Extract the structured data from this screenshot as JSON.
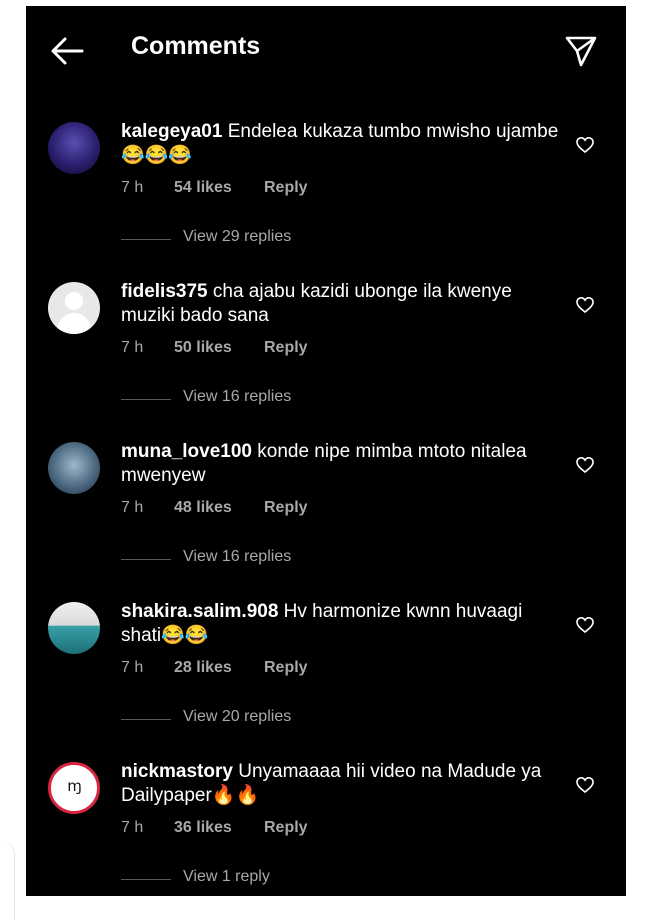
{
  "header": {
    "title": "Comments",
    "back_icon": "arrow-left-icon",
    "send_icon": "paper-plane-icon"
  },
  "comments": [
    {
      "username": "kalegeya01",
      "text": "Endelea kukaza tumbo mwisho ujambe 😂😂😂",
      "time": "7 h",
      "likes": "54 likes",
      "reply": "Reply",
      "view_replies": "View 29 replies"
    },
    {
      "username": "fidelis375",
      "text": "cha ajabu kazidi ubonge ila kwenye muziki bado sana",
      "time": "7 h",
      "likes": "50 likes",
      "reply": "Reply",
      "view_replies": "View 16 replies"
    },
    {
      "username": "muna_love100",
      "text": "konde nipe mimba mtoto nitalea mwenyew",
      "time": "7 h",
      "likes": "48 likes",
      "reply": "Reply",
      "view_replies": "View 16 replies"
    },
    {
      "username": "shakira.salim.908",
      "text": "Hv harmonize kwnn huvaagi shati😂😂",
      "time": "7 h",
      "likes": "28 likes",
      "reply": "Reply",
      "view_replies": "View 20 replies"
    },
    {
      "username": "nickmastory",
      "text": "Unyamaaaa hii video na Madude ya Dailypaper🔥🔥",
      "time": "7 h",
      "likes": "36 likes",
      "reply": "Reply",
      "view_replies": "View 1 reply",
      "avatar_logo": "ɱ"
    }
  ],
  "colors": {
    "background": "#000000",
    "primary_text": "#ffffff",
    "secondary_text": "#a8a8a8"
  }
}
